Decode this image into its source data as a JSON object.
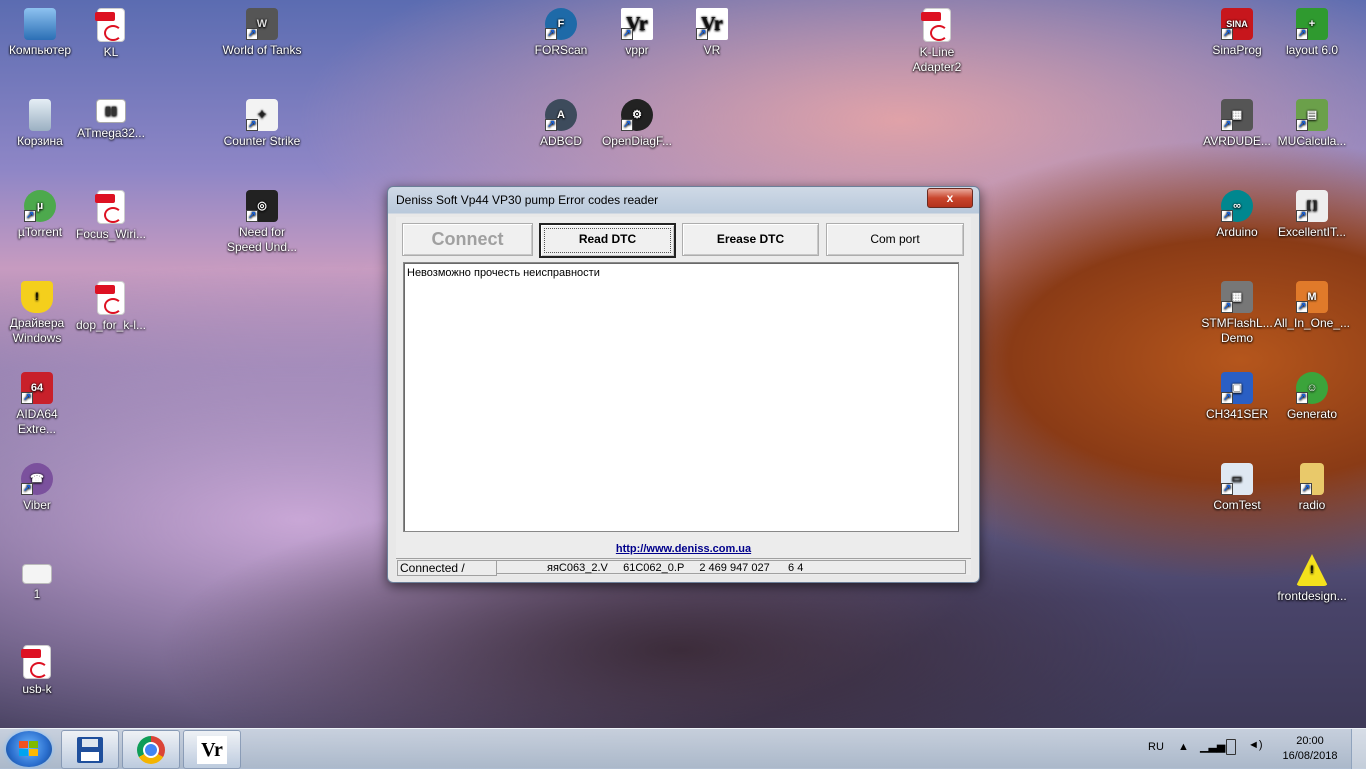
{
  "desktop": {
    "icons": [
      {
        "label": "Компьютер"
      },
      {
        "label": "KL"
      },
      {
        "label": "World of Tanks"
      },
      {
        "label": "FORScan"
      },
      {
        "label": "vppr"
      },
      {
        "label": "VR"
      },
      {
        "label": "K-Line Adapter2"
      },
      {
        "label": "SinaProg"
      },
      {
        "label": "layout 6.0"
      },
      {
        "label": "Корзина"
      },
      {
        "label": "ATmega32..."
      },
      {
        "label": "Counter Strike"
      },
      {
        "label": "ADBCD"
      },
      {
        "label": "OpenDiagF..."
      },
      {
        "label": "AVRDUDE..."
      },
      {
        "label": "MUCalcula..."
      },
      {
        "label": "µTorrent"
      },
      {
        "label": "Focus_Wiri..."
      },
      {
        "label": "Need for Speed Und..."
      },
      {
        "label": "Arduino"
      },
      {
        "label": "ExcellentIT..."
      },
      {
        "label": "Драйвера Windows"
      },
      {
        "label": "dop_for_k-l..."
      },
      {
        "label": "STMFlashL... Demo"
      },
      {
        "label": "All_In_One_..."
      },
      {
        "label": "AIDA64 Extre..."
      },
      {
        "label": "CH341SER"
      },
      {
        "label": "Generato"
      },
      {
        "label": "Viber"
      },
      {
        "label": "ComTest"
      },
      {
        "label": "radio"
      },
      {
        "label": "1"
      },
      {
        "label": "frontdesign..."
      },
      {
        "label": "usb-k"
      }
    ]
  },
  "window": {
    "title": "Deniss Soft  Vp44 VP30 pump Error codes reader",
    "close_label": "x",
    "buttons": {
      "connect": "Connect",
      "read_dtc": "Read DTC",
      "erease_dtc": "Erease DTC",
      "com_port": "Com port"
    },
    "output_text": "Невозможно прочесть неисправности",
    "link": "http://www.deniss.com.ua",
    "status_left": "Connected /",
    "status_right": "яяC063_2.V     61C062_0.P     2 469 947 027      6 4"
  },
  "taskbar": {
    "lang": "RU",
    "time": "20:00",
    "date": "16/08/2018",
    "pinned": [
      {
        "icon": "floppy-disk-icon"
      },
      {
        "icon": "chrome-icon"
      },
      {
        "icon": "vr-app-icon"
      }
    ]
  }
}
